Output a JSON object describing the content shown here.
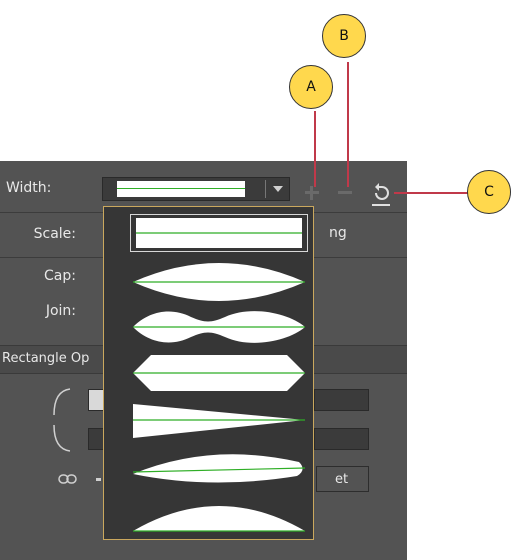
{
  "panel": {
    "width_label": "Width:",
    "scale_label": "Scale:",
    "cap_label": "Cap:",
    "join_label": "Join:",
    "section_title": "Rectangle Op",
    "scale_partial": "ng",
    "reset_partial": "et"
  },
  "width_profiles": [
    {
      "name": "uniform",
      "selected": true
    },
    {
      "name": "width-profile-1",
      "selected": false
    },
    {
      "name": "width-profile-2",
      "selected": false
    },
    {
      "name": "width-profile-3",
      "selected": false
    },
    {
      "name": "width-profile-4",
      "selected": false
    },
    {
      "name": "width-profile-5",
      "selected": false
    },
    {
      "name": "width-profile-6",
      "selected": false
    }
  ],
  "callouts": {
    "a": "A",
    "b": "B",
    "c": "C"
  },
  "colors": {
    "panel_bg": "#535353",
    "popup_border": "#caa85e",
    "profile_line": "#2fae26",
    "callout_fill": "#ffd84d",
    "callout_line": "#c0394a"
  },
  "icons": [
    "plus-icon",
    "minus-icon",
    "reset-icon",
    "link-icon",
    "dropdown-arrow-icon",
    "corner-icon"
  ]
}
